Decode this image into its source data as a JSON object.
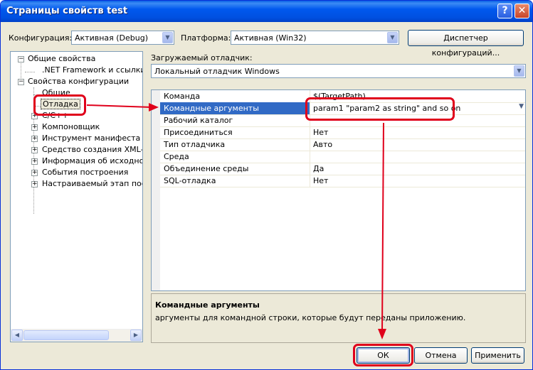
{
  "window": {
    "title": "Страницы свойств test",
    "help_glyph": "?",
    "close_glyph": "✕"
  },
  "config": {
    "configuration_label": "Конфигурация:",
    "configuration_value": "Активная (Debug)",
    "platform_label": "Платформа:",
    "platform_value": "Активная (Win32)",
    "manager_button": "Диспетчер конфигураций..."
  },
  "tree": {
    "items": [
      {
        "label": "Общие свойства",
        "expander": "−"
      },
      {
        "label": ".NET Framework и ссылки"
      },
      {
        "label": "Свойства конфигурации",
        "expander": "−"
      },
      {
        "label": "Общие"
      },
      {
        "label": "Отладка"
      },
      {
        "label": "C/C++",
        "expander": "+"
      },
      {
        "label": "Компоновщик",
        "expander": "+"
      },
      {
        "label": "Инструмент манифеста",
        "expander": "+"
      },
      {
        "label": "Средство создания XML-док",
        "expander": "+"
      },
      {
        "label": "Информация об исходном к",
        "expander": "+"
      },
      {
        "label": "События построения",
        "expander": "+"
      },
      {
        "label": "Настраиваемый этап постро",
        "expander": "+"
      }
    ]
  },
  "debugger": {
    "label": "Загружаемый отладчик:",
    "value": "Локальный отладчик Windows"
  },
  "properties": {
    "rows": [
      {
        "name": "Команда",
        "value": "$(TargetPath)"
      },
      {
        "name": "Командные аргументы",
        "value": "param1 \"param2 as string\" and so on"
      },
      {
        "name": "Рабочий каталог",
        "value": ""
      },
      {
        "name": "Присоединиться",
        "value": "Нет"
      },
      {
        "name": "Тип отладчика",
        "value": "Авто"
      },
      {
        "name": "Среда",
        "value": ""
      },
      {
        "name": "Объединение среды",
        "value": "Да"
      },
      {
        "name": "SQL-отладка",
        "value": "Нет"
      }
    ]
  },
  "description": {
    "title": "Командные аргументы",
    "text": "аргументы для командной строки, которые будут переданы приложению."
  },
  "buttons": {
    "ok": "ОК",
    "cancel": "Отмена",
    "apply": "Применить"
  },
  "glyphs": {
    "dropdown": "▼",
    "scroll_left": "◀",
    "scroll_right": "▶"
  },
  "colors": {
    "annotation": "#E0001B",
    "selection": "#316AC5",
    "titlebar": "#0058EE"
  }
}
